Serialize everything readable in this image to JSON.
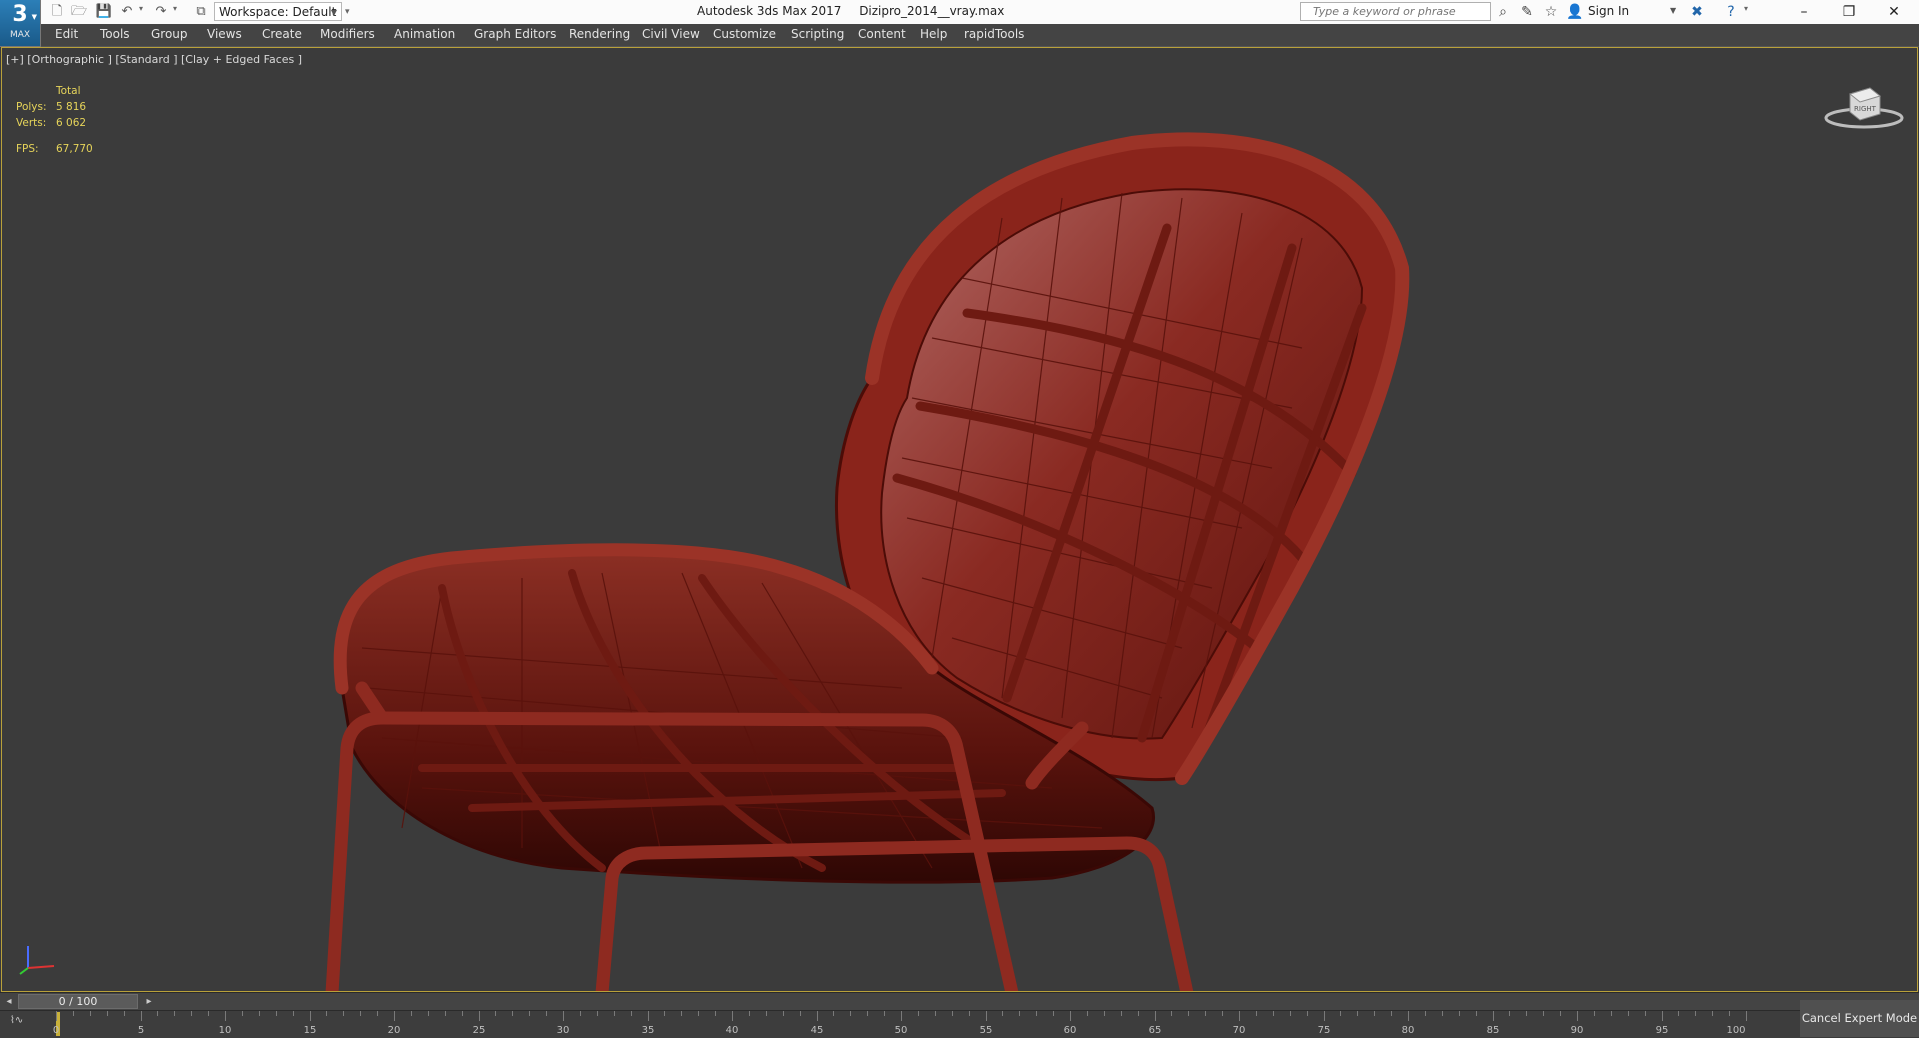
{
  "app": {
    "logo_number": "3",
    "logo_text": "MAX",
    "title": "Autodesk 3ds Max 2017",
    "file": "Dizipro_2014__vray.max",
    "workspace_label": "Workspace: Default"
  },
  "search": {
    "placeholder": "Type a keyword or phrase"
  },
  "account": {
    "sign_in": "Sign In"
  },
  "menu": [
    "Edit",
    "Tools",
    "Group",
    "Views",
    "Create",
    "Modifiers",
    "Animation",
    "Graph Editors",
    "Rendering",
    "Civil View",
    "Customize",
    "Scripting",
    "Content",
    "Help",
    "rapidTools"
  ],
  "viewport": {
    "label": "[+] [Orthographic ] [Standard ] [Clay + Edged Faces ]",
    "stats": {
      "header": "Total",
      "polys_label": "Polys:",
      "polys": "5 816",
      "verts_label": "Verts:",
      "verts": "6 062",
      "fps_label": "FPS:",
      "fps": "67,770"
    },
    "viewcube_label": "RIGHT",
    "mesh_color": "#7a1e16"
  },
  "timeline": {
    "slider": "0 / 100",
    "ticks": [
      "0",
      "5",
      "10",
      "15",
      "20",
      "25",
      "30",
      "35",
      "40",
      "45",
      "50",
      "55",
      "60",
      "65",
      "70",
      "75",
      "80",
      "85",
      "90",
      "95",
      "100"
    ]
  },
  "status": {
    "cancel_expert": "Cancel Expert Mode"
  },
  "colors": {
    "accent": "#c8b13a",
    "viewport_bg": "#3b3b3b",
    "stats": "#e6d45a"
  }
}
